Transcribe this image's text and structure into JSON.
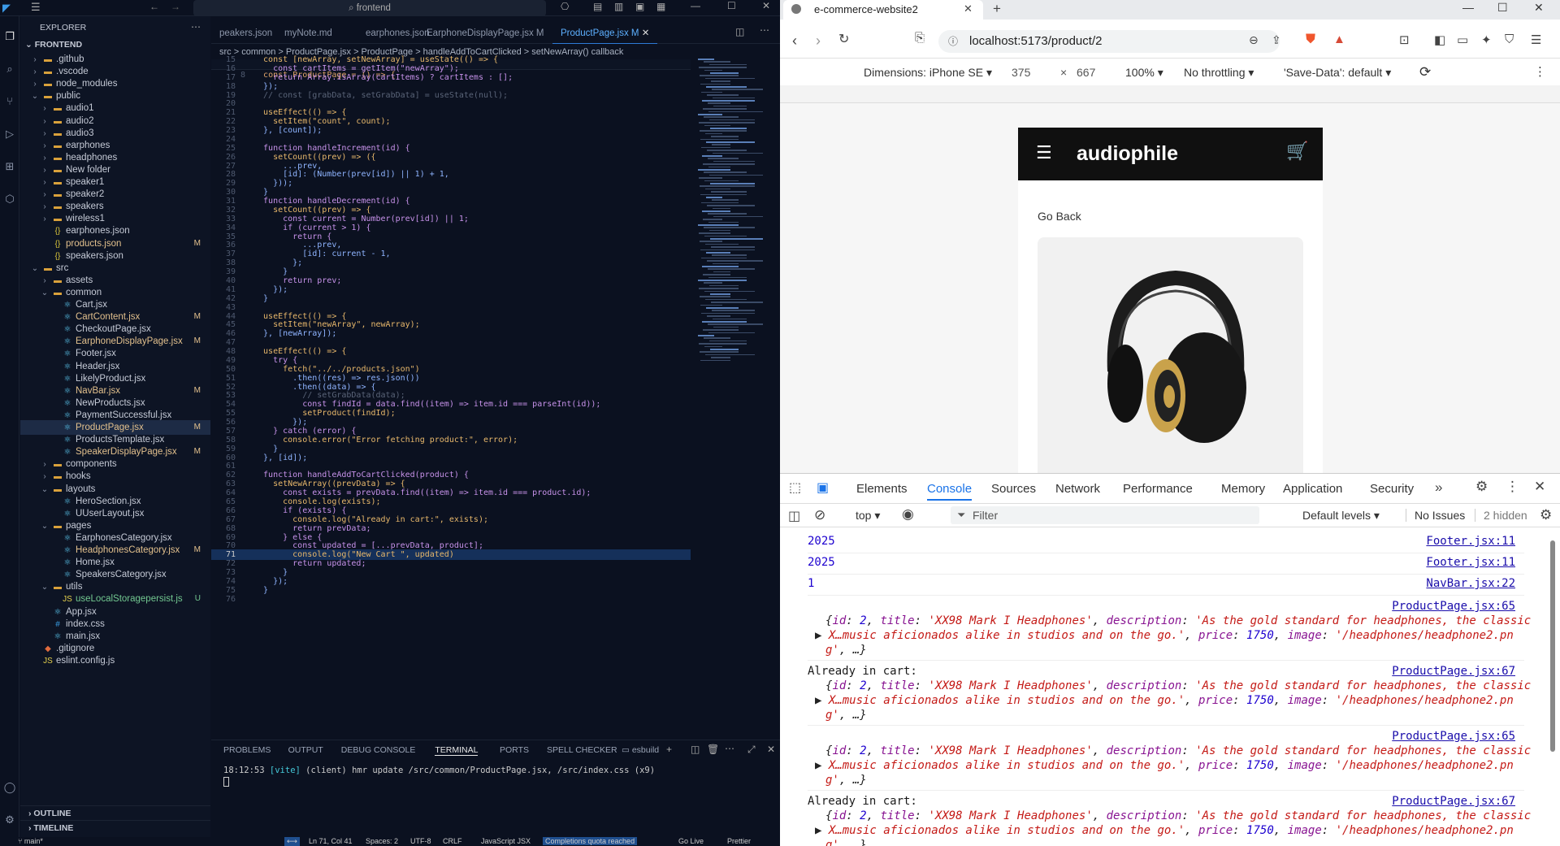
{
  "vscode": {
    "search_text": "frontend",
    "explorer_title": "EXPLORER",
    "root": "FRONTEND",
    "tree": [
      {
        "label": ".github",
        "kind": "folder",
        "depth": 1
      },
      {
        "label": ".vscode",
        "kind": "folder",
        "depth": 1
      },
      {
        "label": "node_modules",
        "kind": "folder",
        "depth": 1
      },
      {
        "label": "public",
        "kind": "folder-open",
        "depth": 1
      },
      {
        "label": "audio1",
        "kind": "folder",
        "depth": 2
      },
      {
        "label": "audio2",
        "kind": "folder",
        "depth": 2
      },
      {
        "label": "audio3",
        "kind": "folder",
        "depth": 2
      },
      {
        "label": "earphones",
        "kind": "folder",
        "depth": 2
      },
      {
        "label": "headphones",
        "kind": "folder",
        "depth": 2
      },
      {
        "label": "New folder",
        "kind": "folder",
        "depth": 2
      },
      {
        "label": "speaker1",
        "kind": "folder",
        "depth": 2
      },
      {
        "label": "speaker2",
        "kind": "folder",
        "depth": 2
      },
      {
        "label": "speakers",
        "kind": "folder",
        "depth": 2
      },
      {
        "label": "wireless1",
        "kind": "folder",
        "depth": 2
      },
      {
        "label": "earphones.json",
        "kind": "json",
        "depth": 2
      },
      {
        "label": "products.json",
        "kind": "json",
        "depth": 2,
        "mod": "M"
      },
      {
        "label": "speakers.json",
        "kind": "json",
        "depth": 2
      },
      {
        "label": "src",
        "kind": "folder-open",
        "depth": 1
      },
      {
        "label": "assets",
        "kind": "folder",
        "depth": 2
      },
      {
        "label": "common",
        "kind": "folder-open",
        "depth": 2
      },
      {
        "label": "Cart.jsx",
        "kind": "jsx",
        "depth": 3
      },
      {
        "label": "CartContent.jsx",
        "kind": "jsx",
        "depth": 3,
        "mod": "M"
      },
      {
        "label": "CheckoutPage.jsx",
        "kind": "jsx",
        "depth": 3
      },
      {
        "label": "EarphoneDisplayPage.jsx",
        "kind": "jsx",
        "depth": 3,
        "mod": "M"
      },
      {
        "label": "Footer.jsx",
        "kind": "jsx",
        "depth": 3
      },
      {
        "label": "Header.jsx",
        "kind": "jsx",
        "depth": 3
      },
      {
        "label": "LikelyProduct.jsx",
        "kind": "jsx",
        "depth": 3
      },
      {
        "label": "NavBar.jsx",
        "kind": "jsx",
        "depth": 3,
        "mod": "M"
      },
      {
        "label": "NewProducts.jsx",
        "kind": "jsx",
        "depth": 3
      },
      {
        "label": "PaymentSuccessful.jsx",
        "kind": "jsx",
        "depth": 3
      },
      {
        "label": "ProductPage.jsx",
        "kind": "jsx",
        "depth": 3,
        "mod": "M",
        "selected": true
      },
      {
        "label": "ProductsTemplate.jsx",
        "kind": "jsx",
        "depth": 3
      },
      {
        "label": "SpeakerDisplayPage.jsx",
        "kind": "jsx",
        "depth": 3,
        "mod": "M"
      },
      {
        "label": "components",
        "kind": "folder",
        "depth": 2
      },
      {
        "label": "hooks",
        "kind": "folder",
        "depth": 2
      },
      {
        "label": "layouts",
        "kind": "folder-open",
        "depth": 2
      },
      {
        "label": "HeroSection.jsx",
        "kind": "jsx",
        "depth": 3
      },
      {
        "label": "UUserLayout.jsx",
        "kind": "jsx",
        "depth": 3
      },
      {
        "label": "pages",
        "kind": "folder-open",
        "depth": 2
      },
      {
        "label": "EarphonesCategory.jsx",
        "kind": "jsx",
        "depth": 3
      },
      {
        "label": "HeadphonesCategory.jsx",
        "kind": "jsx",
        "depth": 3,
        "mod": "M"
      },
      {
        "label": "Home.jsx",
        "kind": "jsx",
        "depth": 3
      },
      {
        "label": "SpeakersCategory.jsx",
        "kind": "jsx",
        "depth": 3
      },
      {
        "label": "utils",
        "kind": "folder-open",
        "depth": 2
      },
      {
        "label": "useLocalStoragepersist.js",
        "kind": "js",
        "depth": 3,
        "mod": "U"
      },
      {
        "label": "App.jsx",
        "kind": "jsx",
        "depth": 2
      },
      {
        "label": "index.css",
        "kind": "css",
        "depth": 2
      },
      {
        "label": "main.jsx",
        "kind": "jsx",
        "depth": 2
      },
      {
        "label": ".gitignore",
        "kind": "git",
        "depth": 1
      },
      {
        "label": "eslint.config.js",
        "kind": "js",
        "depth": 1
      }
    ],
    "outline": "OUTLINE",
    "timeline": "TIMELINE",
    "tabs": [
      {
        "label": "peakers.json"
      },
      {
        "label": "myNote.md"
      },
      {
        "label": "earphones.json"
      },
      {
        "label": "EarphoneDisplayPage.jsx M"
      },
      {
        "label": "ProductPage.jsx M",
        "active": true
      }
    ],
    "breadcrumb": "src > common > ProductPage.jsx > ProductPage > handleAddToCartClicked > setNewArray() callback",
    "sticky_line": {
      "num": "8",
      "text": "const ProductPage = () => {"
    },
    "code": [
      {
        "num": "15",
        "text": "  const [newArray, setNewArray] = useState(() => {"
      },
      {
        "num": "16",
        "text": "    const cartItems = getItem(\"newArray\");"
      },
      {
        "num": "17",
        "text": "    return Array.isArray(cartItems) ? cartItems : [];"
      },
      {
        "num": "18",
        "text": "  });"
      },
      {
        "num": "19",
        "text": "  // const [grabData, setGrabData] = useState(null);"
      },
      {
        "num": "20",
        "text": ""
      },
      {
        "num": "21",
        "text": "  useEffect(() => {"
      },
      {
        "num": "22",
        "text": "    setItem(\"count\", count);"
      },
      {
        "num": "23",
        "text": "  }, [count]);"
      },
      {
        "num": "24",
        "text": ""
      },
      {
        "num": "25",
        "text": "  function handleIncrement(id) {"
      },
      {
        "num": "26",
        "text": "    setCount((prev) => ({"
      },
      {
        "num": "27",
        "text": "      ...prev,"
      },
      {
        "num": "28",
        "text": "      [id]: (Number(prev[id]) || 1) + 1,"
      },
      {
        "num": "29",
        "text": "    }));"
      },
      {
        "num": "30",
        "text": "  }"
      },
      {
        "num": "31",
        "text": "  function handleDecrement(id) {"
      },
      {
        "num": "32",
        "text": "    setCount((prev) => {"
      },
      {
        "num": "33",
        "text": "      const current = Number(prev[id]) || 1;"
      },
      {
        "num": "34",
        "text": "      if (current > 1) {"
      },
      {
        "num": "35",
        "text": "        return {"
      },
      {
        "num": "36",
        "text": "          ...prev,"
      },
      {
        "num": "37",
        "text": "          [id]: current - 1,"
      },
      {
        "num": "38",
        "text": "        };"
      },
      {
        "num": "39",
        "text": "      }"
      },
      {
        "num": "40",
        "text": "      return prev;"
      },
      {
        "num": "41",
        "text": "    });"
      },
      {
        "num": "42",
        "text": "  }"
      },
      {
        "num": "43",
        "text": ""
      },
      {
        "num": "44",
        "text": "  useEffect(() => {"
      },
      {
        "num": "45",
        "text": "    setItem(\"newArray\", newArray);"
      },
      {
        "num": "46",
        "text": "  }, [newArray]);"
      },
      {
        "num": "47",
        "text": ""
      },
      {
        "num": "48",
        "text": "  useEffect(() => {"
      },
      {
        "num": "49",
        "text": "    try {"
      },
      {
        "num": "50",
        "text": "      fetch(\"../../products.json\")"
      },
      {
        "num": "51",
        "text": "        .then((res) => res.json())"
      },
      {
        "num": "52",
        "text": "        .then((data) => {"
      },
      {
        "num": "53",
        "text": "          // setGrabData(data);"
      },
      {
        "num": "54",
        "text": "          const findId = data.find((item) => item.id === parseInt(id));"
      },
      {
        "num": "55",
        "text": "          setProduct(findId);"
      },
      {
        "num": "56",
        "text": "        });"
      },
      {
        "num": "57",
        "text": "    } catch (error) {"
      },
      {
        "num": "58",
        "text": "      console.error(\"Error fetching product:\", error);"
      },
      {
        "num": "59",
        "text": "    }"
      },
      {
        "num": "60",
        "text": "  }, [id]);"
      },
      {
        "num": "61",
        "text": ""
      },
      {
        "num": "62",
        "text": "  function handleAddToCartClicked(product) {"
      },
      {
        "num": "63",
        "text": "    setNewArray((prevData) => {"
      },
      {
        "num": "64",
        "text": "      const exists = prevData.find((item) => item.id === product.id);"
      },
      {
        "num": "65",
        "text": "      console.log(exists);"
      },
      {
        "num": "66",
        "text": "      if (exists) {"
      },
      {
        "num": "67",
        "text": "        console.log(\"Already in cart:\", exists);"
      },
      {
        "num": "68",
        "text": "        return prevData;"
      },
      {
        "num": "69",
        "text": "      } else {"
      },
      {
        "num": "70",
        "text": "        const updated = [...prevData, product];"
      },
      {
        "num": "71",
        "text": "        console.log(\"New Cart \", updated)",
        "current": true
      },
      {
        "num": "72",
        "text": "        return updated;"
      },
      {
        "num": "73",
        "text": "      }"
      },
      {
        "num": "74",
        "text": "    });"
      },
      {
        "num": "75",
        "text": "  }"
      },
      {
        "num": "76",
        "text": ""
      }
    ],
    "panel_tabs": [
      "PROBLEMS",
      "OUTPUT",
      "DEBUG CONSOLE",
      "TERMINAL",
      "PORTS",
      "SPELL CHECKER"
    ],
    "terminal_name": "esbuild",
    "terminal_time": "18:12:53",
    "terminal_vite": "[vite]",
    "terminal_msg": "(client) hmr update /src/common/ProductPage.jsx, /src/index.css (x9)",
    "status": {
      "branch": "main*",
      "position": "Ln 71, Col 41",
      "spaces": "Spaces: 2",
      "encoding": "UTF-8",
      "eol": "CRLF",
      "language": "JavaScript JSX",
      "completions": "Completions quota reached",
      "golive": "Go Live",
      "prettier": "Prettier"
    }
  },
  "browser": {
    "tab_title": "e-commerce-website2",
    "url": "localhost:5173/product/2",
    "device": "Dimensions: iPhone SE",
    "width": "375",
    "height": "667",
    "zoom": "100%",
    "throttle": "No throttling",
    "savedata": "'Save-Data': default",
    "site": {
      "logo": "audiophile",
      "go_back": "Go Back"
    },
    "devtools": {
      "tabs": [
        "Elements",
        "Console",
        "Sources",
        "Network",
        "Performance",
        "Memory",
        "Application",
        "Security"
      ],
      "active_tab": "Console",
      "context": "top",
      "filter_placeholder": "Filter",
      "levels": "Default levels",
      "issues": "No Issues",
      "hidden": "2 hidden"
    },
    "console": [
      {
        "text": "2025",
        "src": "Footer.jsx:11",
        "color": "#1c00cf"
      },
      {
        "text": "2025",
        "src": "Footer.jsx:11",
        "color": "#1c00cf"
      },
      {
        "text": "1",
        "src": "NavBar.jsx:22",
        "color": "#1c00cf"
      }
    ],
    "obj_entries": [
      {
        "prefix": "",
        "src": "ProductPage.jsx:65"
      },
      {
        "prefix": "Already in cart:",
        "src": "ProductPage.jsx:67"
      },
      {
        "prefix": "",
        "src": "ProductPage.jsx:65"
      },
      {
        "prefix": "Already in cart:",
        "src": "ProductPage.jsx:67"
      }
    ],
    "obj": {
      "id": "2",
      "title": "'XX98 Mark I Headphones'",
      "description_1": "'As the gold standard for headphones, the classic",
      "description_2": "X…music aficionados alike in studios and on the go.'",
      "price": "1750",
      "image_1": "'/headphones/headphone2.pn",
      "image_2": "g'"
    }
  }
}
